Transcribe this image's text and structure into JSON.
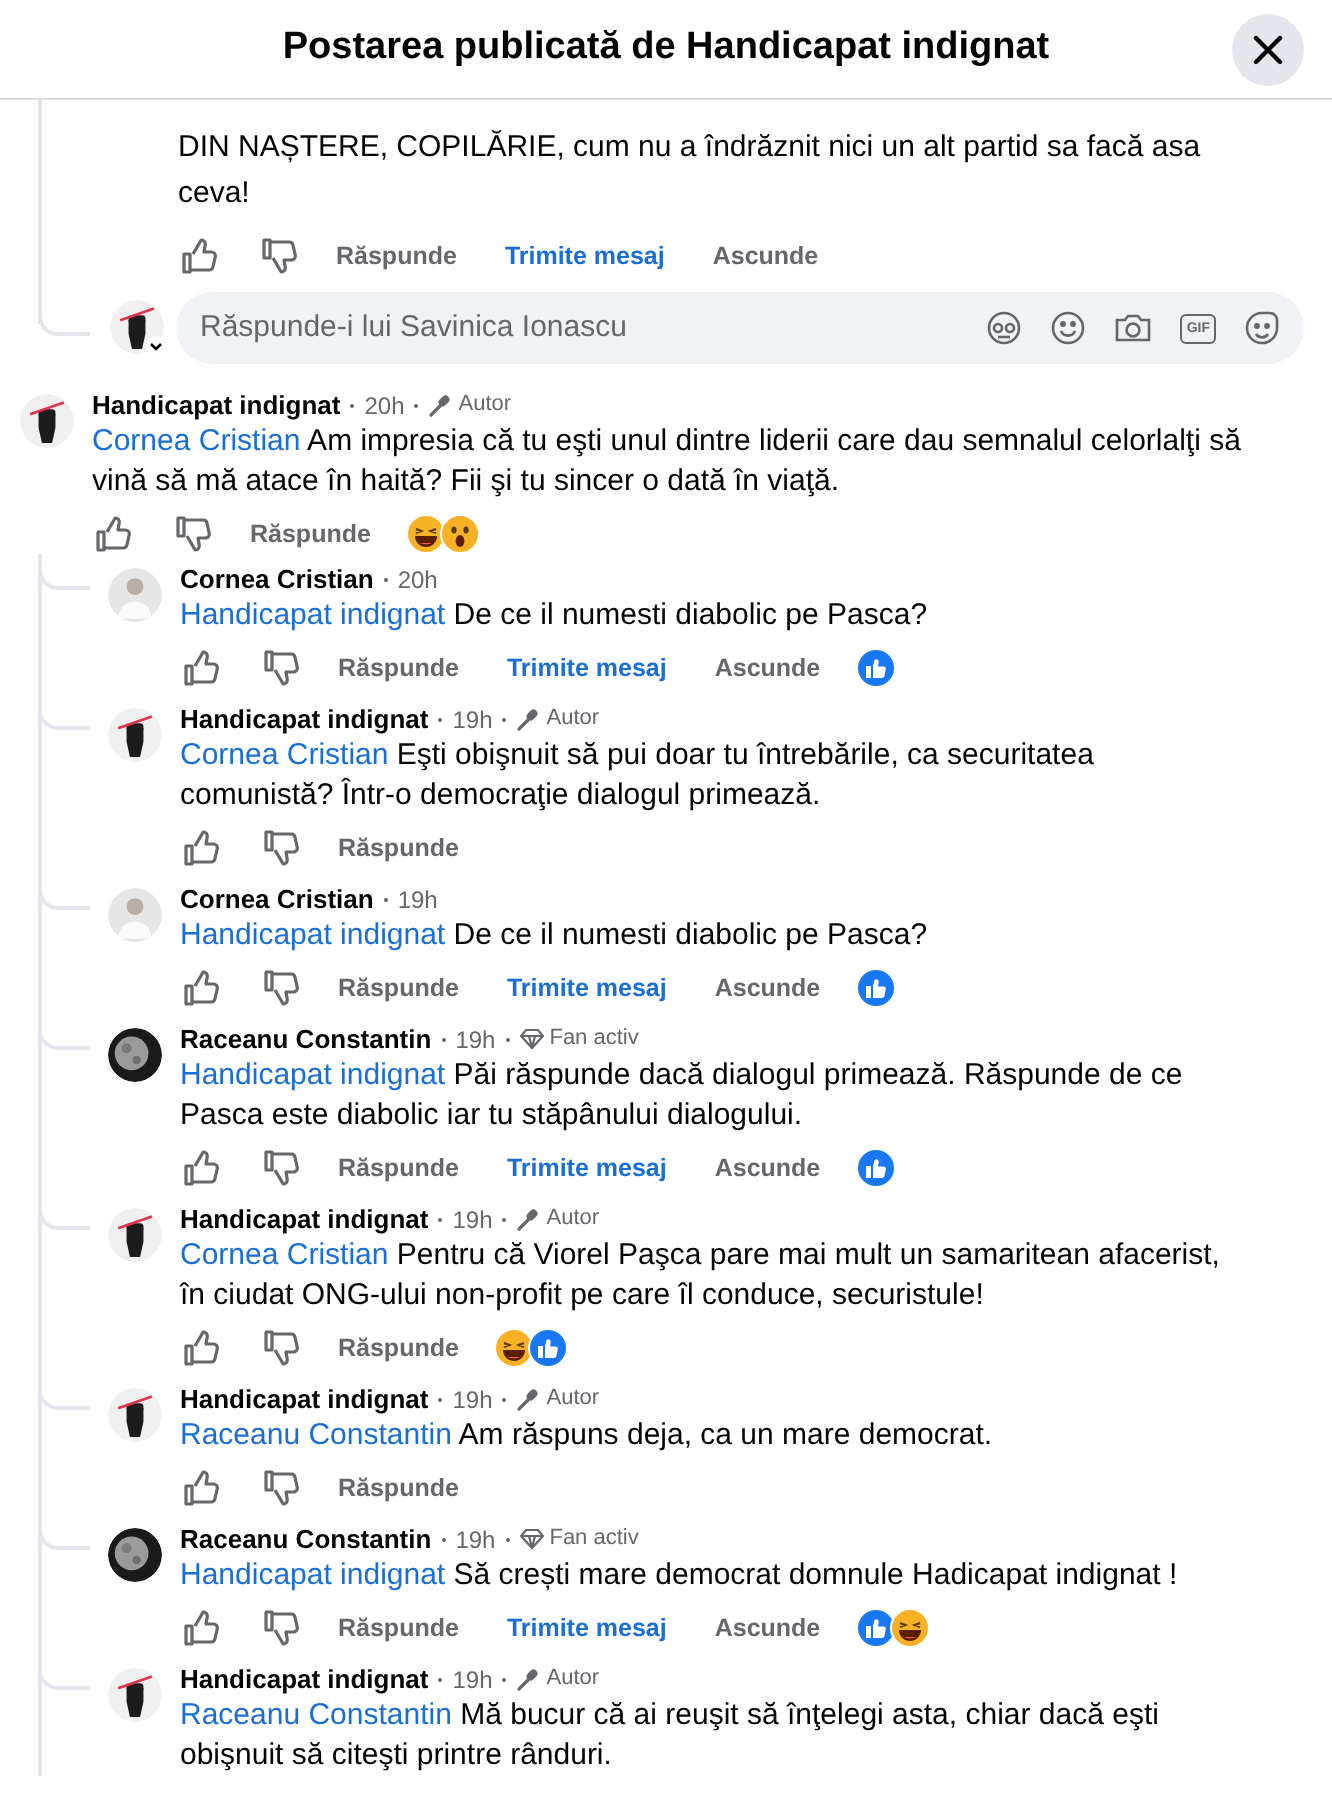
{
  "header": {
    "title": "Postarea publicată de Handicapat indignat"
  },
  "partial_comment": {
    "text": "DIN NAȘTERE, COPILĂRIE, cum nu a îndrăznit nici un alt partid sa facă asa ceva!",
    "actions": [
      {
        "kind": "reply",
        "label": "Răspunde"
      },
      {
        "kind": "message",
        "label": "Trimite mesaj"
      },
      {
        "kind": "hide",
        "label": "Ascunde"
      }
    ]
  },
  "reply_box": {
    "placeholder": "Răspunde-i lui Savinica Ionascu",
    "gif_label": "GIF"
  },
  "comments": [
    {
      "avatar": {
        "kind": "fist"
      },
      "author": "Handicapat indignat",
      "time": "20h",
      "badge": {
        "kind": "author",
        "label": "Autor"
      },
      "mention": "Cornea Cristian",
      "text": "Am impresia că tu eşti unul dintre liderii care dau semnalul celorlalţi să vină să mă atace în haită? Fii şi tu sincer o dată în viaţă.",
      "actions": [
        {
          "kind": "reply",
          "label": "Răspunde"
        }
      ],
      "reactions": [
        {
          "kind": "haha"
        },
        {
          "kind": "wow"
        }
      ],
      "children": [
        {
          "avatar": {
            "kind": "person"
          },
          "author": "Cornea Cristian",
          "time": "20h",
          "mention": "Handicapat indignat",
          "text": "De ce il numesti diabolic pe Pasca?",
          "actions": [
            {
              "kind": "reply",
              "label": "Răspunde"
            },
            {
              "kind": "message",
              "label": "Trimite mesaj"
            },
            {
              "kind": "hide",
              "label": "Ascunde"
            }
          ],
          "reactions": [
            {
              "kind": "like"
            }
          ]
        },
        {
          "avatar": {
            "kind": "fist"
          },
          "author": "Handicapat indignat",
          "time": "19h",
          "badge": {
            "kind": "author",
            "label": "Autor"
          },
          "mention": "Cornea Cristian",
          "text": "Eşti obişnuit să pui doar tu întrebările, ca securitatea comunistă? Într-o democraţie dialogul primează.",
          "actions": [
            {
              "kind": "reply",
              "label": "Răspunde"
            }
          ]
        },
        {
          "avatar": {
            "kind": "person"
          },
          "author": "Cornea Cristian",
          "time": "19h",
          "mention": "Handicapat indignat",
          "text": "De ce il numesti diabolic pe Pasca?",
          "actions": [
            {
              "kind": "reply",
              "label": "Răspunde"
            },
            {
              "kind": "message",
              "label": "Trimite mesaj"
            },
            {
              "kind": "hide",
              "label": "Ascunde"
            }
          ],
          "reactions": [
            {
              "kind": "like"
            }
          ]
        },
        {
          "avatar": {
            "kind": "moon"
          },
          "author": "Raceanu Constantin",
          "time": "19h",
          "badge": {
            "kind": "fan",
            "label": "Fan activ"
          },
          "mention": "Handicapat indignat",
          "text": "Păi răspunde dacă dialogul primează. Răspunde de ce Pasca este diabolic iar tu stăpânului dialogului.",
          "actions": [
            {
              "kind": "reply",
              "label": "Răspunde"
            },
            {
              "kind": "message",
              "label": "Trimite mesaj"
            },
            {
              "kind": "hide",
              "label": "Ascunde"
            }
          ],
          "reactions": [
            {
              "kind": "like"
            }
          ]
        },
        {
          "avatar": {
            "kind": "fist"
          },
          "author": "Handicapat indignat",
          "time": "19h",
          "badge": {
            "kind": "author",
            "label": "Autor"
          },
          "mention": "Cornea Cristian",
          "text": "Pentru că Viorel Paşca pare mai mult un samaritean afacerist, în ciudat ONG-ului non-profit pe care îl conduce, securistule!",
          "actions": [
            {
              "kind": "reply",
              "label": "Răspunde"
            }
          ],
          "reactions": [
            {
              "kind": "haha"
            },
            {
              "kind": "like"
            }
          ]
        },
        {
          "avatar": {
            "kind": "fist"
          },
          "author": "Handicapat indignat",
          "time": "19h",
          "badge": {
            "kind": "author",
            "label": "Autor"
          },
          "mention": "Raceanu Constantin",
          "text": "Am răspuns deja, ca un mare democrat.",
          "actions": [
            {
              "kind": "reply",
              "label": "Răspunde"
            }
          ]
        },
        {
          "avatar": {
            "kind": "moon"
          },
          "author": "Raceanu Constantin",
          "time": "19h",
          "badge": {
            "kind": "fan",
            "label": "Fan activ"
          },
          "mention": "Handicapat indignat",
          "text": "Să crești mare democrat domnule Hadicapat indignat !",
          "actions": [
            {
              "kind": "reply",
              "label": "Răspunde"
            },
            {
              "kind": "message",
              "label": "Trimite mesaj"
            },
            {
              "kind": "hide",
              "label": "Ascunde"
            }
          ],
          "reactions": [
            {
              "kind": "like"
            },
            {
              "kind": "haha"
            }
          ]
        },
        {
          "avatar": {
            "kind": "fist"
          },
          "author": "Handicapat indignat",
          "time": "19h",
          "badge": {
            "kind": "author",
            "label": "Autor"
          },
          "mention": "Raceanu Constantin",
          "text": "Mă bucur că ai reuşit să înţelegi asta, chiar dacă eşti obişnuit să citeşti printre rânduri."
        }
      ]
    }
  ]
}
